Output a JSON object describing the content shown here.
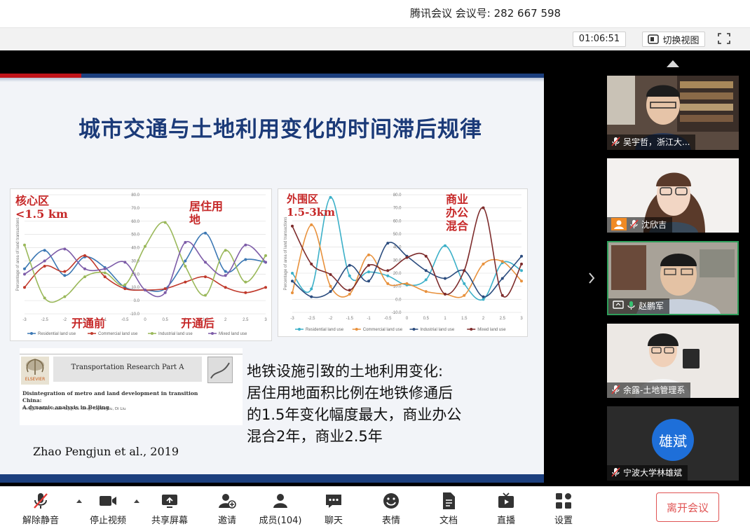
{
  "titlebar": {
    "app_name": "腾讯会议",
    "meeting_label": "会议号:",
    "meeting_id": "282 667 598"
  },
  "subbar": {
    "timer": "01:06:51",
    "switch_view_label": "切换视图"
  },
  "slide": {
    "title": "城市交通与土地利用变化的时间滞后规律",
    "chart_left": {
      "zone_label_1": "核心区",
      "zone_label_2": "<1.5 km",
      "before_label": "开通前",
      "after_label": "开通后",
      "peak_label_1": "居住用",
      "peak_label_2": "地"
    },
    "chart_right": {
      "zone_label_1": "外围区",
      "zone_label_2": "1.5-3km",
      "peak_label_1": "商业",
      "peak_label_2": "办公",
      "peak_label_3": "混合"
    },
    "paper": {
      "journal": "Transportation Research Part A",
      "publisher": "ELSEVIER",
      "title_line1": "Disintegration of metro and land development in transition China:",
      "title_line2": "A dynamic analysis in Beijing",
      "authors": "Pengjun Zhao, Haoxi Yang, Lu Kong, Yumbo Liu, Di Liu"
    },
    "finding_line1": "地铁设施引致的土地利用变化:",
    "finding_line2": "居住用地面积比例在地铁修通后",
    "finding_line3": "的1.5年变化幅度最大，商业办公",
    "finding_line4": "混合2年，商业2.5年",
    "citation": "Zhao Pengjun et al., 2019"
  },
  "chart_data": [
    {
      "type": "line",
      "x": [
        -3,
        -2.5,
        -2,
        -1.5,
        -1,
        -0.5,
        0,
        0.5,
        1,
        1.5,
        2,
        2.5,
        3
      ],
      "ylim": [
        -10,
        80
      ],
      "ylabel": "Percentage of area of land transactions",
      "series": [
        {
          "name": "Residential land use",
          "color": "#3c78b4",
          "values": [
            24,
            38,
            19,
            33,
            25,
            10,
            8,
            9,
            30,
            51,
            22,
            31,
            29
          ]
        },
        {
          "name": "Commercial land use",
          "color": "#c0392b",
          "values": [
            10,
            26,
            22,
            34,
            18,
            9,
            8,
            9,
            14,
            18,
            10,
            6,
            10
          ]
        },
        {
          "name": "Industrial land use",
          "color": "#9ab85a",
          "values": [
            42,
            2,
            3,
            18,
            21,
            12,
            41,
            59,
            26,
            4,
            38,
            14,
            34
          ]
        },
        {
          "name": "Mixed land use",
          "color": "#7d5ca8",
          "values": [
            20,
            30,
            39,
            24,
            24,
            29,
            8,
            6,
            44,
            29,
            19,
            42,
            29
          ]
        }
      ]
    },
    {
      "type": "line",
      "x": [
        -3,
        -2.5,
        -2,
        -1.5,
        -1,
        -0.5,
        0,
        0.5,
        1,
        1.5,
        2,
        2.5,
        3
      ],
      "ylim": [
        -10,
        80
      ],
      "ylabel": "Percentage of area of land transactions",
      "series": [
        {
          "name": "Residential land use",
          "color": "#3cb0c8",
          "values": [
            20,
            8,
            78,
            18,
            21,
            18,
            11,
            15,
            41,
            12,
            0,
            28,
            22
          ]
        },
        {
          "name": "Commercial land use",
          "color": "#e8913c",
          "values": [
            5,
            57,
            10,
            4,
            34,
            12,
            12,
            6,
            4,
            3,
            27,
            29,
            14
          ]
        },
        {
          "name": "Industrial land use",
          "color": "#2b4c7e",
          "values": [
            14,
            2,
            6,
            26,
            14,
            43,
            33,
            22,
            16,
            22,
            2,
            16,
            33
          ]
        },
        {
          "name": "Mixed land use",
          "color": "#7d2b2b",
          "values": [
            56,
            27,
            19,
            7,
            26,
            22,
            32,
            33,
            4,
            22,
            70,
            3,
            27
          ]
        }
      ]
    }
  ],
  "participants": [
    {
      "name": "吴宇哲，浙江大...",
      "muted": true
    },
    {
      "name": "沈欣吉",
      "muted": true
    },
    {
      "name": "赵鹏军",
      "muted": false
    },
    {
      "name": "余露-土地管理系",
      "muted": true
    },
    {
      "name": "宁波大学林雄斌",
      "muted": true,
      "avatar_text": "雄斌"
    }
  ],
  "toolbar": {
    "unmute": "解除静音",
    "stop_video": "停止视频",
    "share_screen": "共享屏幕",
    "invite": "邀请",
    "members": "成员(104)",
    "chat": "聊天",
    "reactions": "表情",
    "docs": "文档",
    "live": "直播",
    "settings": "设置",
    "leave": "离开会议"
  }
}
